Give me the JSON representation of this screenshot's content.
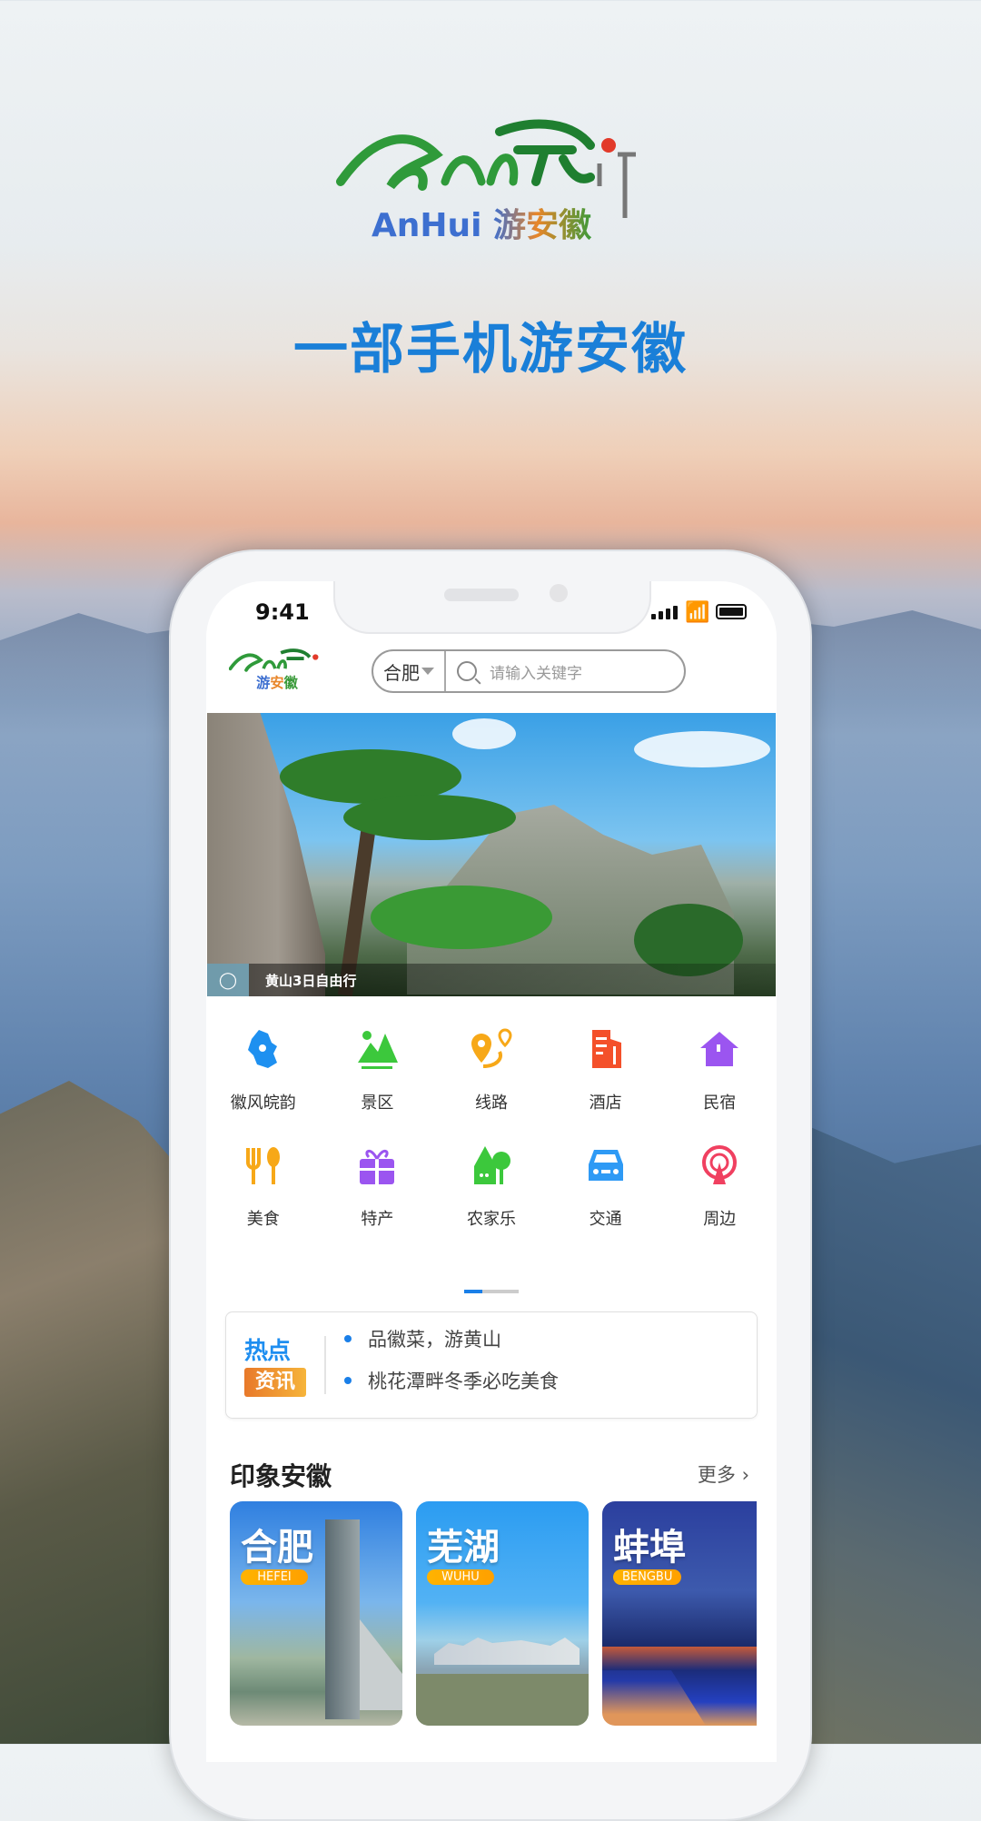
{
  "promo": {
    "logo_text": "AnHui 游安徽",
    "slogan": "一部手机游安徽"
  },
  "status_bar": {
    "time": "9:41"
  },
  "header": {
    "logo_text": "AnHui 游安徽",
    "city": "合肥",
    "search_placeholder": "请输入关键字"
  },
  "banner": {
    "caption": "黄山3日自由行"
  },
  "categories": [
    {
      "label": "徽风皖韵",
      "icon": "anhui-map-icon",
      "color": "#1e90f0"
    },
    {
      "label": "景区",
      "icon": "mountain-icon",
      "color": "#3cc83c"
    },
    {
      "label": "线路",
      "icon": "route-icon",
      "color": "#f7a818"
    },
    {
      "label": "酒店",
      "icon": "hotel-icon",
      "color": "#f4502a"
    },
    {
      "label": "民宿",
      "icon": "house-icon",
      "color": "#9b55f0"
    },
    {
      "label": "美食",
      "icon": "fork-spoon-icon",
      "color": "#f7a818"
    },
    {
      "label": "特产",
      "icon": "gift-icon",
      "color": "#9b55f0"
    },
    {
      "label": "农家乐",
      "icon": "farmhouse-icon",
      "color": "#3cc83c"
    },
    {
      "label": "交通",
      "icon": "car-icon",
      "color": "#2e9af5"
    },
    {
      "label": "周边",
      "icon": "ferris-wheel-icon",
      "color": "#f04060"
    }
  ],
  "hot_news": {
    "badge_top": "热点",
    "badge_bottom": "资讯",
    "items": [
      "品徽菜，游黄山",
      "桃花潭畔冬季必吃美食"
    ]
  },
  "section": {
    "title": "印象安徽",
    "more": "更多",
    "cities": [
      {
        "name": "合肥",
        "en": "HEFEI"
      },
      {
        "name": "芜湖",
        "en": "WUHU"
      },
      {
        "name": "蚌埠",
        "en": "BENGBU"
      }
    ]
  },
  "colors": {
    "accent": "#1a7fe8",
    "slogan": "#1a7fd8",
    "badge": "#ffa000"
  }
}
